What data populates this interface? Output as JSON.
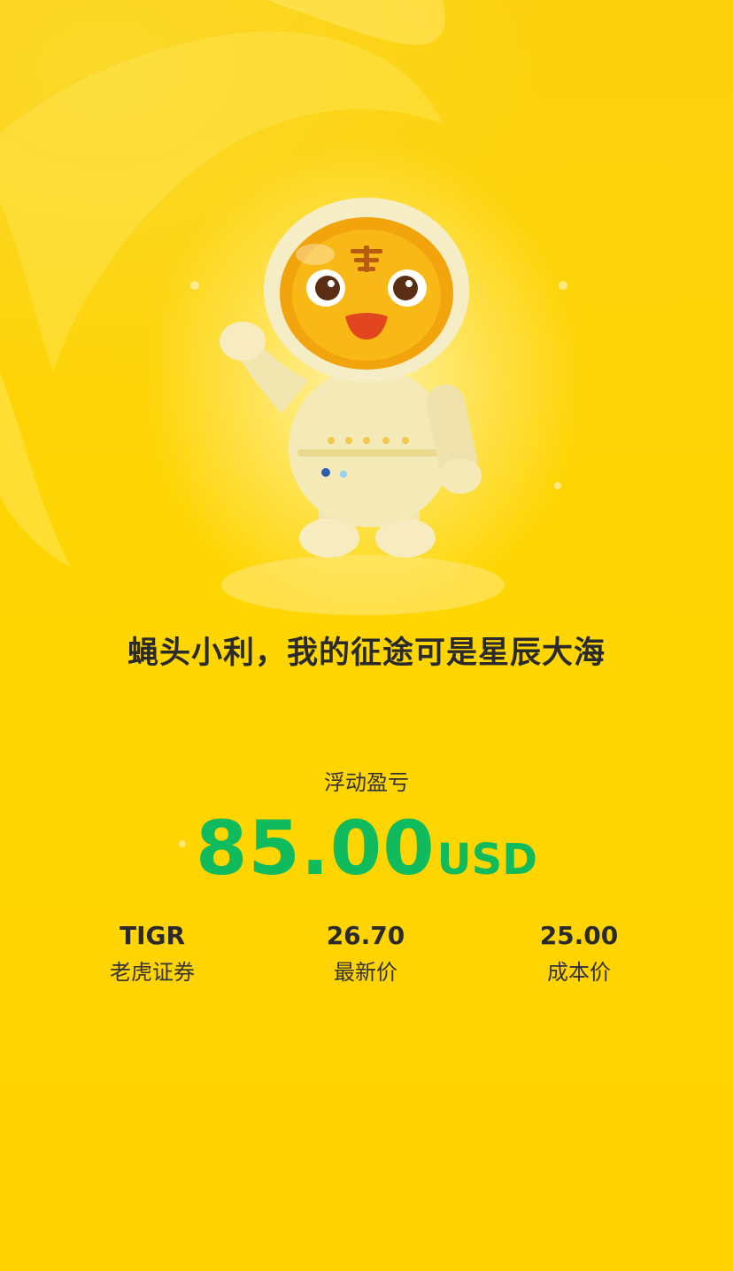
{
  "tagline": "蝇头小利，我的征途可是星辰大海",
  "pnl": {
    "label": "浮动盈亏",
    "value": "85.00",
    "currency": "USD"
  },
  "stats": {
    "symbol": {
      "value": "TIGR",
      "label": "老虎证券"
    },
    "last_price": {
      "value": "26.70",
      "label": "最新价"
    },
    "cost_price": {
      "value": "25.00",
      "label": "成本价"
    }
  },
  "colors": {
    "background": "#ffd200",
    "profit": "#0fbb5c",
    "text": "#2a2a2a"
  },
  "mascot": {
    "icon": "tiger-astronaut-mascot"
  }
}
